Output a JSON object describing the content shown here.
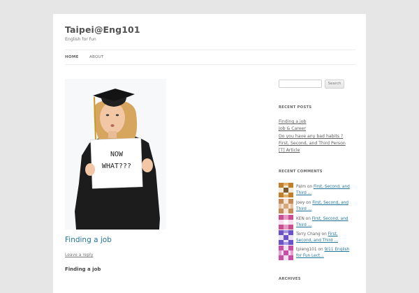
{
  "site": {
    "title": "Taipei@Eng101",
    "description": "English for fun"
  },
  "nav": {
    "items": [
      {
        "label": "HOME",
        "active": true
      },
      {
        "label": "ABOUT",
        "active": false
      }
    ]
  },
  "featured_image": {
    "sign_line1": "NOW",
    "sign_line2": "WHAT???"
  },
  "post": {
    "title": "Finding a job",
    "reply_label": "Leave a reply",
    "entry_heading": "Finding a job"
  },
  "sidebar": {
    "search": {
      "value": "",
      "button_label": "Search"
    },
    "recent_posts": {
      "title": "RECENT POSTS",
      "items": [
        "Finding a job",
        "Job & Career",
        "Do you have any bad habits ?",
        "First, Second, and Third Person",
        "[T] Article"
      ]
    },
    "recent_comments": {
      "title": "RECENT COMMENTS",
      "on_word": "on",
      "items": [
        {
          "author": "Palm",
          "link": "First, Second, and Third ..."
        },
        {
          "author": "Joey",
          "link": "First, Second, and Third ..."
        },
        {
          "author": "KEN",
          "link": "First, Second, and Third ..."
        },
        {
          "author": "Terry Chang",
          "link": "First, Second, and Third ..."
        },
        {
          "author": "tpieng101",
          "link": "9/11 English for Fun Lect..."
        }
      ]
    },
    "archives": {
      "title": "ARCHIVES"
    }
  },
  "colors": {
    "link": "#21759b",
    "page_bg": "#e6e6e6",
    "identicons": [
      "#c27f2a",
      "#c58c57",
      "#c94f93",
      "#6b52c6",
      "#c84fa6"
    ]
  }
}
